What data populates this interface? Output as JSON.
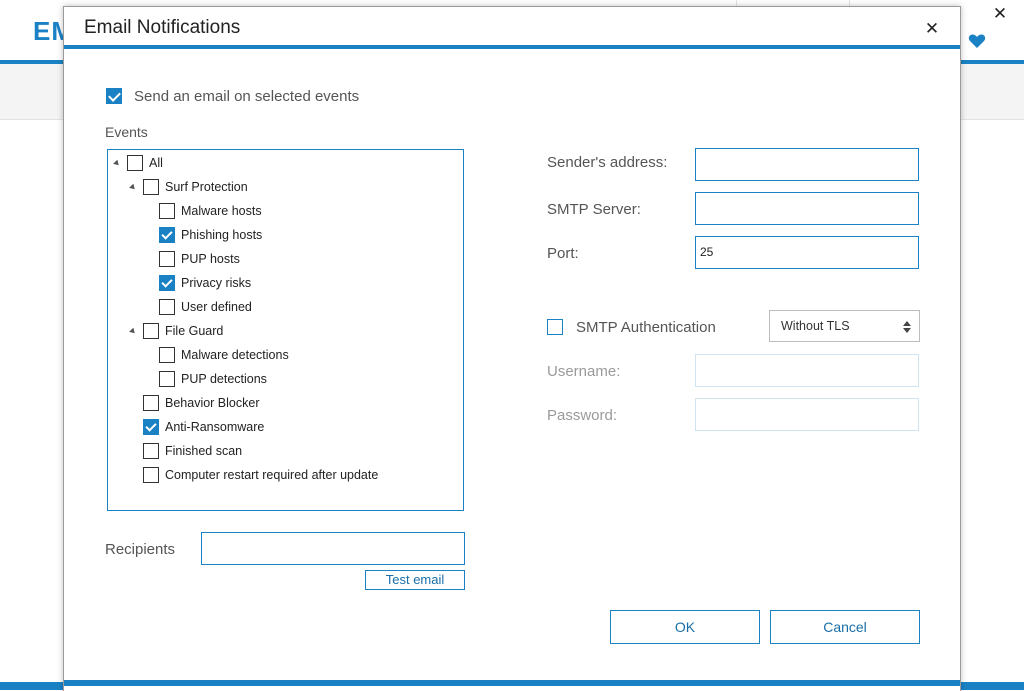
{
  "app": {
    "logo_text": "EM",
    "close_glyph": "✕",
    "heart_icon": "heart-icon",
    "accent_color": "#1a82c4"
  },
  "dialog": {
    "title": "Email Notifications",
    "close_glyph": "✕",
    "send_email": {
      "label": "Send an email on selected events",
      "checked": true
    },
    "events_label": "Events",
    "tree": [
      {
        "label": "All",
        "checked": false,
        "expanded": true
      },
      {
        "label": "Surf Protection",
        "checked": false,
        "expanded": true
      },
      {
        "label": "Malware hosts",
        "checked": false
      },
      {
        "label": "Phishing hosts",
        "checked": true
      },
      {
        "label": "PUP hosts",
        "checked": false
      },
      {
        "label": "Privacy risks",
        "checked": true
      },
      {
        "label": "User defined",
        "checked": false
      },
      {
        "label": "File Guard",
        "checked": false,
        "expanded": true
      },
      {
        "label": "Malware detections",
        "checked": false
      },
      {
        "label": "PUP detections",
        "checked": false
      },
      {
        "label": "Behavior Blocker",
        "checked": false
      },
      {
        "label": "Anti-Ransomware",
        "checked": true
      },
      {
        "label": "Finished scan",
        "checked": false
      },
      {
        "label": "Computer restart required after update",
        "checked": false
      }
    ],
    "recipients_label": "Recipients",
    "recipients_value": "",
    "test_email_label": "Test email",
    "sender_label": "Sender's address:",
    "sender_value": "",
    "smtp_server_label": "SMTP Server:",
    "smtp_server_value": "",
    "port_label": "Port:",
    "port_value": "25",
    "smtp_auth": {
      "label": "SMTP Authentication",
      "checked": false
    },
    "tls_selected": "Without TLS",
    "username_label": "Username:",
    "username_value": "",
    "password_label": "Password:",
    "password_value": "",
    "ok_label": "OK",
    "cancel_label": "Cancel"
  }
}
